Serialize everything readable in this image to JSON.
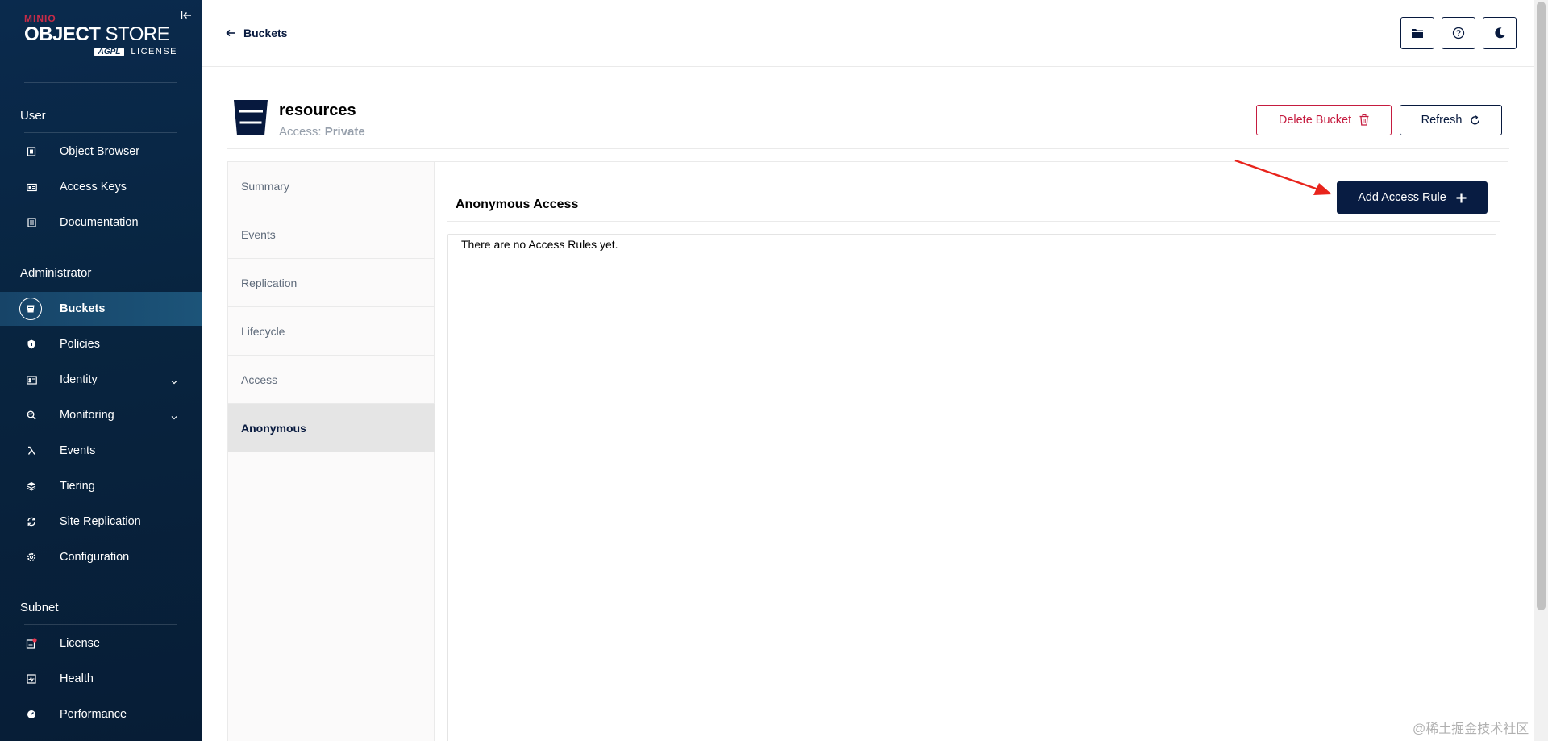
{
  "sidebar": {
    "logo": {
      "brand": "MINIO",
      "product_bold": "OBJECT",
      "product_light": "STORE",
      "badge": "AGPL",
      "license": "LICENSE"
    },
    "sections": {
      "user": "User",
      "administrator": "Administrator",
      "subnet": "Subnet"
    },
    "items": {
      "object_browser": "Object Browser",
      "access_keys": "Access Keys",
      "documentation": "Documentation",
      "buckets": "Buckets",
      "policies": "Policies",
      "identity": "Identity",
      "monitoring": "Monitoring",
      "events": "Events",
      "tiering": "Tiering",
      "site_replication": "Site Replication",
      "configuration": "Configuration",
      "license": "License",
      "health": "Health",
      "performance": "Performance"
    }
  },
  "topbar": {
    "back_label": "Buckets"
  },
  "bucket": {
    "name": "resources",
    "access_label": "Access:",
    "access_value": "Private",
    "delete_label": "Delete Bucket",
    "refresh_label": "Refresh"
  },
  "tabs": {
    "summary": "Summary",
    "events": "Events",
    "replication": "Replication",
    "lifecycle": "Lifecycle",
    "access": "Access",
    "anonymous": "Anonymous"
  },
  "anonymous": {
    "title": "Anonymous Access",
    "add_rule_label": "Add Access Rule",
    "empty_message": "There are no Access Rules yet."
  },
  "watermark": "@稀土掘金技术社区",
  "colors": {
    "sidebar_bg": "#0a2a4d",
    "primary": "#081c42",
    "danger": "#c51b3f",
    "annotation_arrow": "#e8241c"
  }
}
